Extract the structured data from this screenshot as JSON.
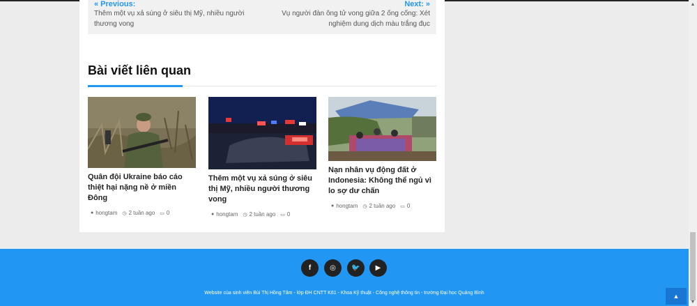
{
  "post_nav": {
    "prev_label": "« Previous:",
    "prev_title": "Thêm một vụ xả súng ở siêu thị Mỹ, nhiều người thương vong",
    "next_label": "Next: »",
    "next_title": "Vụ người đàn ông tử vong giữa 2 ống cống: Xét nghiệm dung dịch màu trắng đục"
  },
  "related": {
    "heading": "Bài viết liên quan",
    "cards": [
      {
        "title": "Quân đội Ukraine báo cáo thiệt hại nặng nề ở miền Đông",
        "author": "hongtam",
        "time": "2 tuần ago",
        "comments": "0"
      },
      {
        "title": "Thêm một vụ xả súng ở siêu thị Mỹ, nhiều người thương vong",
        "author": "hongtam",
        "time": "2 tuần ago",
        "comments": "0"
      },
      {
        "title": "Nạn nhân vụ động đất ở Indonesia: Không thể ngủ vì lo sợ dư chấn",
        "author": "hongtam",
        "time": "2 tuần ago",
        "comments": "0"
      }
    ]
  },
  "footer": {
    "social": [
      {
        "icon": "facebook-icon",
        "glyph": "f"
      },
      {
        "icon": "instagram-icon",
        "glyph": "◎"
      },
      {
        "icon": "twitter-icon",
        "glyph": "🐦"
      },
      {
        "icon": "youtube-icon",
        "glyph": "▶"
      }
    ],
    "text": "Website của sinh viên Bùi Thị Hồng Tâm - lớp ĐH CNTT K61 - Khoa Kỹ thuật - Công nghệ thông tin - trường Đại học Quảng Bình",
    "accent_color": "#2196f3"
  }
}
